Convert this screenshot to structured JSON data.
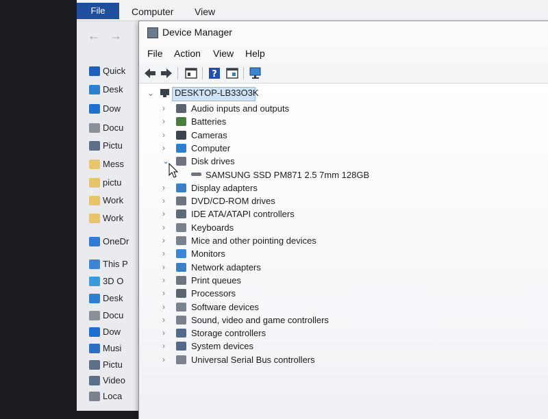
{
  "explorer": {
    "menu": [
      "File",
      "Computer",
      "View"
    ],
    "sidebar": [
      {
        "label": "Quick",
        "icon": "star-icon",
        "color": "#1e5fbf"
      },
      {
        "label": "Desk",
        "icon": "desktop-icon",
        "color": "#2f7fd0"
      },
      {
        "label": "Dow",
        "icon": "download-icon",
        "color": "#1f6fd1"
      },
      {
        "label": "Docu",
        "icon": "document-icon",
        "color": "#8a9099"
      },
      {
        "label": "Pictu",
        "icon": "pictures-icon",
        "color": "#5a6f88"
      },
      {
        "label": "Mess",
        "icon": "folder-icon",
        "color": "#e8c46a"
      },
      {
        "label": "pictu",
        "icon": "folder-icon",
        "color": "#e8c46a"
      },
      {
        "label": "Work",
        "icon": "folder-icon",
        "color": "#e8c46a"
      },
      {
        "label": "Work",
        "icon": "folder-icon",
        "color": "#e8c46a"
      },
      {
        "label": "OneDr",
        "icon": "cloud-icon",
        "color": "#2d7bd3"
      },
      {
        "label": "This P",
        "icon": "pc-icon",
        "color": "#3a86d4"
      },
      {
        "label": "3D O",
        "icon": "3d-objects-icon",
        "color": "#3a9bd9"
      },
      {
        "label": "Desk",
        "icon": "desktop-icon",
        "color": "#2f7fd0"
      },
      {
        "label": "Docu",
        "icon": "document-icon",
        "color": "#8a9099"
      },
      {
        "label": "Dow",
        "icon": "download-icon",
        "color": "#1f6fd1"
      },
      {
        "label": "Musi",
        "icon": "music-icon",
        "color": "#2d6fc2"
      },
      {
        "label": "Pictu",
        "icon": "pictures-icon",
        "color": "#5a6f88"
      },
      {
        "label": "Video",
        "icon": "video-icon",
        "color": "#5a6f88"
      },
      {
        "label": "Loca",
        "icon": "drive-icon",
        "color": "#7a8290"
      }
    ]
  },
  "device_manager": {
    "title": "Device Manager",
    "menu": [
      "File",
      "Action",
      "View",
      "Help"
    ],
    "toolbar": [
      "back-icon",
      "forward-icon",
      "properties-icon",
      "help-icon",
      "update-driver-icon",
      "scan-hardware-icon"
    ],
    "root": "DESKTOP-LB33O3K",
    "categories": [
      {
        "label": "Audio inputs and outputs",
        "icon": "speaker-icon",
        "color": "#5b6370",
        "expanded": false
      },
      {
        "label": "Batteries",
        "icon": "battery-icon",
        "color": "#4a7d3a",
        "expanded": false
      },
      {
        "label": "Cameras",
        "icon": "camera-icon",
        "color": "#3d4450",
        "expanded": false
      },
      {
        "label": "Computer",
        "icon": "computer-icon",
        "color": "#2f7fd0",
        "expanded": false
      },
      {
        "label": "Disk drives",
        "icon": "disk-drive-icon",
        "color": "#6e757f",
        "expanded": true,
        "children": [
          {
            "label": "SAMSUNG SSD PM871 2.5 7mm 128GB",
            "icon": "disk-drive-icon",
            "color": "#6e757f"
          }
        ]
      },
      {
        "label": "Display adapters",
        "icon": "display-adapter-icon",
        "color": "#3b7fc4",
        "expanded": false
      },
      {
        "label": "DVD/CD-ROM drives",
        "icon": "dvd-drive-icon",
        "color": "#6e757f",
        "expanded": false
      },
      {
        "label": "IDE ATA/ATAPI controllers",
        "icon": "ide-controller-icon",
        "color": "#5d6a7a",
        "expanded": false
      },
      {
        "label": "Keyboards",
        "icon": "keyboard-icon",
        "color": "#7a828d",
        "expanded": false
      },
      {
        "label": "Mice and other pointing devices",
        "icon": "mouse-icon",
        "color": "#7a828d",
        "expanded": false
      },
      {
        "label": "Monitors",
        "icon": "monitor-icon",
        "color": "#3b86d3",
        "expanded": false
      },
      {
        "label": "Network adapters",
        "icon": "network-adapter-icon",
        "color": "#3b7fc4",
        "expanded": false
      },
      {
        "label": "Print queues",
        "icon": "printer-icon",
        "color": "#6e757f",
        "expanded": false
      },
      {
        "label": "Processors",
        "icon": "processor-icon",
        "color": "#5d6670",
        "expanded": false
      },
      {
        "label": "Software devices",
        "icon": "software-device-icon",
        "color": "#7a828d",
        "expanded": false
      },
      {
        "label": "Sound, video and game controllers",
        "icon": "sound-controller-icon",
        "color": "#7a828d",
        "expanded": false
      },
      {
        "label": "Storage controllers",
        "icon": "storage-controller-icon",
        "color": "#4f6a8a",
        "expanded": false
      },
      {
        "label": "System devices",
        "icon": "system-device-icon",
        "color": "#4f6a8a",
        "expanded": false
      },
      {
        "label": "Universal Serial Bus controllers",
        "icon": "usb-icon",
        "color": "#7a828d",
        "expanded": false
      }
    ]
  }
}
